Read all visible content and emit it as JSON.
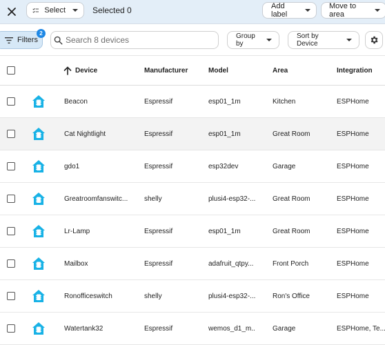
{
  "topbar": {
    "select_label": "Select",
    "selected_text": "Selected 0",
    "add_label": "Add label",
    "move_to_area": "Move to area"
  },
  "toolbar": {
    "filters_label": "Filters",
    "filters_count": "2",
    "search_placeholder": "Search 8 devices",
    "group_by": "Group by",
    "sort_by": "Sort by Device"
  },
  "table": {
    "headers": {
      "device": "Device",
      "manufacturer": "Manufacturer",
      "model": "Model",
      "area": "Area",
      "integration": "Integration"
    },
    "rows": [
      {
        "device": "Beacon",
        "manufacturer": "Espressif",
        "model": "esp01_1m",
        "area": "Kitchen",
        "integration": "ESPHome"
      },
      {
        "device": "Cat Nightlight",
        "manufacturer": "Espressif",
        "model": "esp01_1m",
        "area": "Great Room",
        "integration": "ESPHome"
      },
      {
        "device": "gdo1",
        "manufacturer": "Espressif",
        "model": "esp32dev",
        "area": "Garage",
        "integration": "ESPHome"
      },
      {
        "device": "Greatroomfanswitc...",
        "manufacturer": "shelly",
        "model": "plusi4-esp32-...",
        "area": "Great Room",
        "integration": "ESPHome"
      },
      {
        "device": "Lr-Lamp",
        "manufacturer": "Espressif",
        "model": "esp01_1m",
        "area": "Great Room",
        "integration": "ESPHome"
      },
      {
        "device": "Mailbox",
        "manufacturer": "Espressif",
        "model": "adafruit_qtpy...",
        "area": "Front Porch",
        "integration": "ESPHome"
      },
      {
        "device": "Ronofficeswitch",
        "manufacturer": "shelly",
        "model": "plusi4-esp32-...",
        "area": "Ron's Office",
        "integration": "ESPHome"
      },
      {
        "device": "Watertank32",
        "manufacturer": "Espressif",
        "model": "wemos_d1_m...",
        "area": "Garage",
        "integration": "ESPHome, Te..."
      }
    ]
  },
  "colors": {
    "accent": "#1e88e5",
    "esphome_icon": "#18b2e6",
    "topbar_bg": "#e3eef8",
    "hover_row": "#f3f3f3"
  },
  "icons": {
    "close": "close-icon",
    "select": "checklist-icon",
    "filter": "filter-icon",
    "search": "search-icon",
    "settings": "gear-icon",
    "sort": "arrow-up-icon",
    "device": "esphome-icon"
  }
}
